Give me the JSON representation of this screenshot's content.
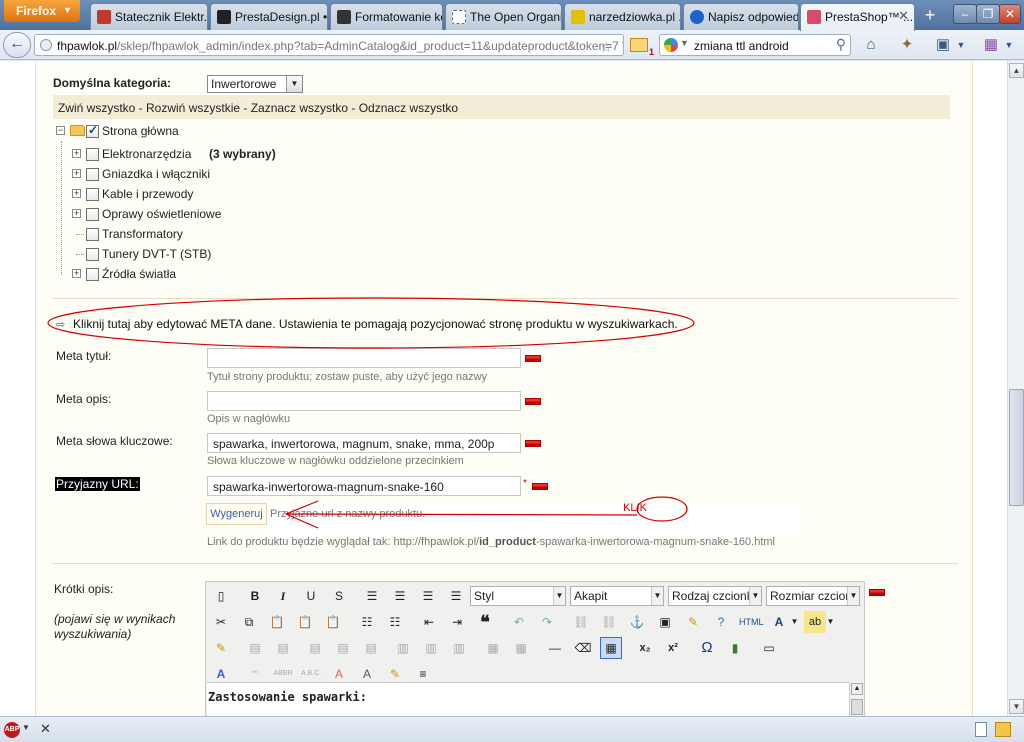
{
  "browser": {
    "menu_button": "Firefox",
    "tabs": [
      {
        "title": "Statecznik Elektr...",
        "icon_color": "#c0392b"
      },
      {
        "title": "PrestaDesign.pl •...",
        "icon_color": "#222222"
      },
      {
        "title": "Formatowanie ko...",
        "icon_color": "#333333"
      },
      {
        "title": "The Open Organi...",
        "icon_color": "#ffffff"
      },
      {
        "title": "narzedziowka.pl ...",
        "icon_color": "#e2c200"
      },
      {
        "title": "Napisz odpowied...",
        "icon_color": "#1a64c8"
      },
      {
        "title": "PrestaShop™ ...",
        "icon_color": "#d84c6a"
      }
    ],
    "new_tab": "+",
    "url_host": "fhpawlok.pl",
    "url_rest": "/sklep/fhpawlok_admin/index.php?tab=AdminCatalog&id_product=11&updateproduct&token=7",
    "mail_count": "1",
    "search_value": "zmiana ttl android"
  },
  "form": {
    "default_category_label": "Domyślna kategoria:",
    "default_category_value": "Inwertorowe",
    "tree_actions": "Zwiń wszystko - Rozwiń wszystkie - Zaznacz wszystko - Odznacz wszystko",
    "root_category": "Strona główna",
    "categories": [
      {
        "name": "Elektronarzędzia",
        "extra": "(3 wybrany)"
      },
      {
        "name": "Gniazdka i włączniki",
        "extra": ""
      },
      {
        "name": "Kable i przewody",
        "extra": ""
      },
      {
        "name": "Oprawy oświetleniowe",
        "extra": ""
      },
      {
        "name": "Transformatory",
        "extra": ""
      },
      {
        "name": "Tunery DVT-T (STB)",
        "extra": ""
      },
      {
        "name": "Źródła światła",
        "extra": ""
      }
    ],
    "meta_link": "Kliknij tutaj aby edytować META dane. Ustawienia te pomagają pozycjonować stronę produktu w wyszukiwarkach.",
    "meta_title_label": "Meta tytuł:",
    "meta_title_value": "",
    "meta_title_hint": "Tytuł strony produktu; zostaw puste, aby użyć jego nazwy",
    "meta_desc_label": "Meta opis:",
    "meta_desc_value": "",
    "meta_desc_hint": "Opis w nagłówku",
    "meta_keywords_label": "Meta słowa kluczowe:",
    "meta_keywords_value": "spawarka, inwertorowa, magnum, snake, mma, 200p",
    "meta_keywords_hint": "Słowa kluczowe w nagłówku oddzielone przecinkiem",
    "friendly_url_label": "Przyjazny URL:",
    "friendly_url_value": "spawarka-inwertorowa-magnum-snake-160",
    "required_mark": "*",
    "generate_button": "Wygeneruj",
    "generate_hint": "Przyjazne url z nazwy produktu.",
    "link_preview_prefix": "Link do produktu będzie wyglądał tak: http://fhpawlok.pl/",
    "link_preview_bold": "id_product",
    "link_preview_suffix": "-spawarka-inwertorowa-magnum-snake-160.html",
    "short_desc_label": "Krótki opis:",
    "short_desc_note": "(pojawi się w wynikach wyszukiwania)",
    "annotation_label": "KLIK"
  },
  "editor": {
    "style_combo": "Styl",
    "format_combo": "Akapit",
    "font_combo": "Rodzaj czcionki",
    "size_combo": "Rozmiar czcionki",
    "content_first_line": "Zastosowanie spawarki:"
  },
  "statusbar": {
    "addon_label": "ABP"
  },
  "colors": {
    "annotation_red": "#d40000",
    "content_bg": "#fffef6",
    "tree_bar_bg": "#f3ecd6",
    "firefox_orange": "#e2700f"
  }
}
